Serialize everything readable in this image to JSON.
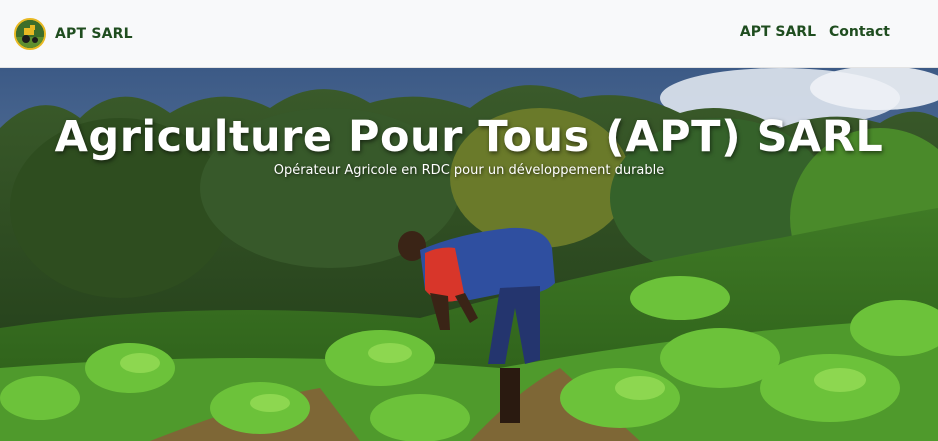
{
  "navbar": {
    "brand_name": "APT SARL",
    "logo_icon": "tractor-logo-icon",
    "links": [
      {
        "label": "APT SARL"
      },
      {
        "label": "Contact"
      }
    ]
  },
  "hero": {
    "title": "Agriculture Pour Tous (APT) SARL",
    "subtitle": "Opérateur Agricole en RDC pour un développement durable",
    "image_subject": "farmer-tending-crops-photo"
  },
  "colors": {
    "navbar_bg": "#f8f9fa",
    "brand_text": "#1f4d1f",
    "hero_text": "#ffffff"
  }
}
